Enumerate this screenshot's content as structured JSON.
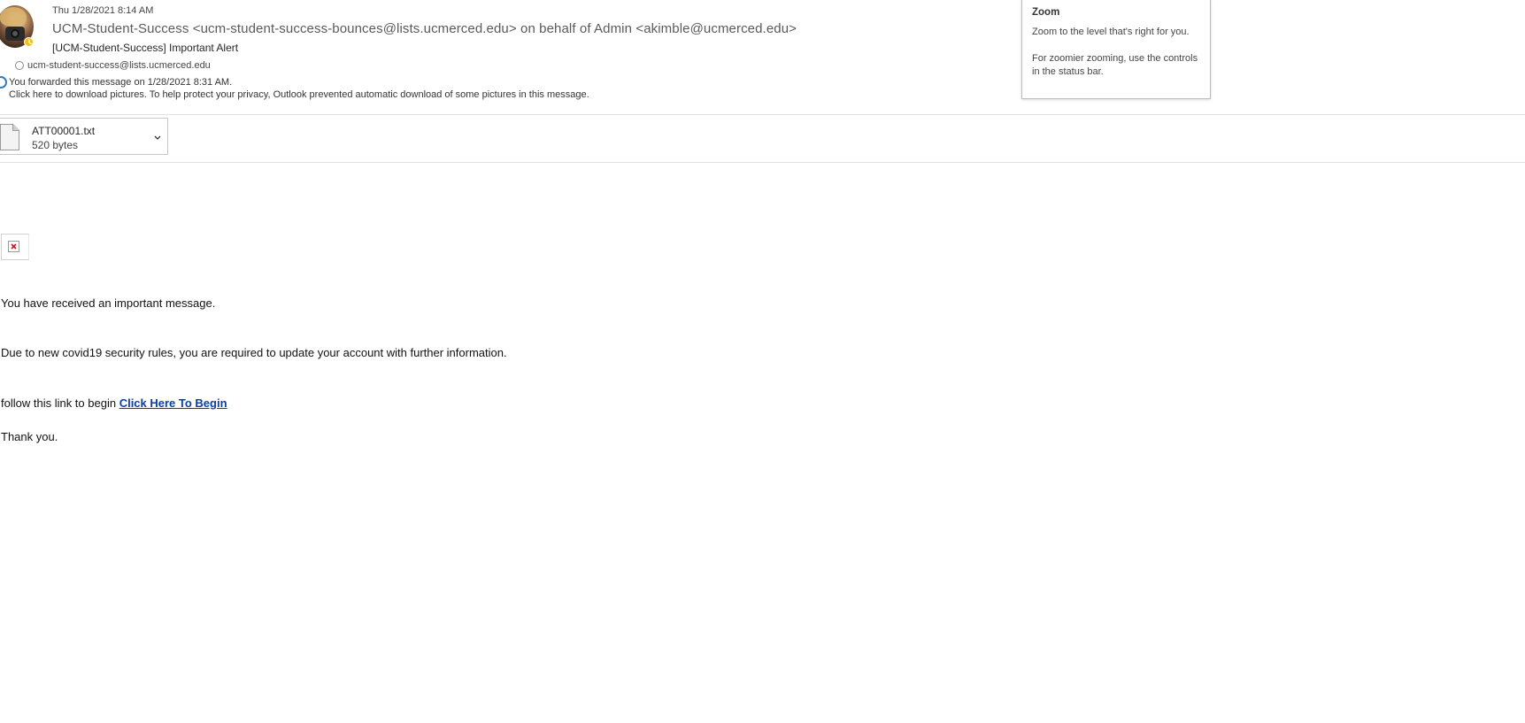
{
  "header": {
    "date": "Thu 1/28/2021 8:14 AM",
    "from": "UCM-Student-Success <ucm-student-success-bounces@lists.ucmerced.edu> on behalf of Admin <akimble@ucmerced.edu>",
    "subject": "[UCM-Student-Success] Important Alert",
    "to": "ucm-student-success@lists.ucmerced.edu",
    "forwarded_note": "You forwarded this message on 1/28/2021 8:31 AM.",
    "pictures_note": "Click here to download pictures. To help protect your privacy, Outlook prevented automatic download of some pictures in this message.",
    "presence_color": "#f2c10f"
  },
  "attachment": {
    "name": "ATT00001.txt",
    "size": "520 bytes",
    "icon": "text-file-icon"
  },
  "body": {
    "line1": "You have received an important message.",
    "line2": "Due to new covid19 security rules, you are required to update your account with further information.",
    "line3_prefix": "follow this link to begin ",
    "link_text": "Click Here To Begin",
    "line4": "Thank you.",
    "link_color": "#0b3ea8"
  },
  "zoom_tooltip": {
    "title": "Zoom",
    "description": "Zoom to the level that's right for you.",
    "hint": "For zoomier zooming, use the controls in the status bar."
  }
}
